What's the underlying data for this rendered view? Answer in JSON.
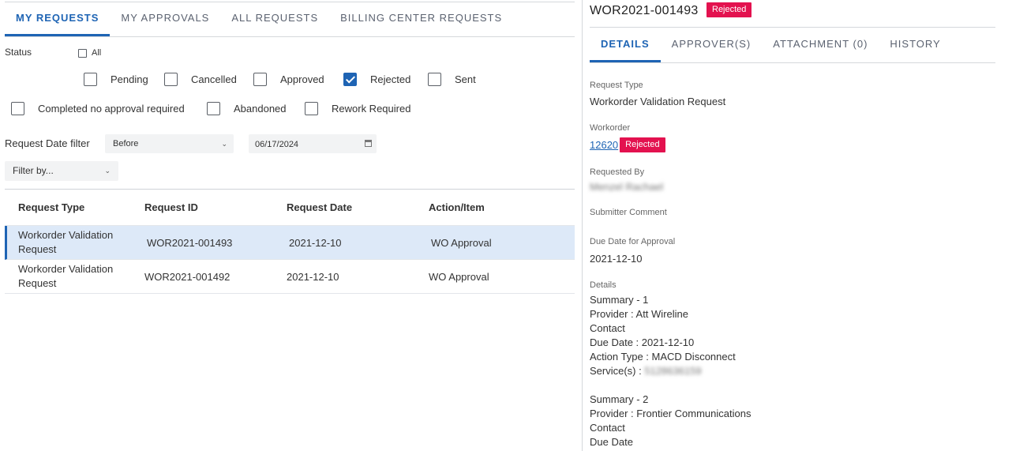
{
  "left": {
    "tabs": [
      {
        "label": "MY REQUESTS",
        "active": true
      },
      {
        "label": "MY APPROVALS",
        "active": false
      },
      {
        "label": "ALL REQUESTS",
        "active": false
      },
      {
        "label": "BILLING CENTER REQUESTS",
        "active": false
      }
    ],
    "status": {
      "label": "Status",
      "all_label": "All",
      "options_row1": [
        {
          "label": "Pending",
          "checked": false
        },
        {
          "label": "Cancelled",
          "checked": false
        },
        {
          "label": "Approved",
          "checked": false
        },
        {
          "label": "Rejected",
          "checked": true
        },
        {
          "label": "Sent",
          "checked": false
        }
      ],
      "options_row2": [
        {
          "label": "Completed no approval required",
          "checked": false
        },
        {
          "label": "Abandoned",
          "checked": false
        },
        {
          "label": "Rework Required",
          "checked": false
        }
      ]
    },
    "date_filter": {
      "label": "Request Date filter",
      "operator": "Before",
      "date": "06/17/2024"
    },
    "filter_by": {
      "placeholder": "Filter by..."
    },
    "table": {
      "headers": [
        "Request Type",
        "Request ID",
        "Request Date",
        "Action/Item"
      ],
      "rows": [
        {
          "type": "Workorder Validation Request",
          "id": "WOR2021-001493",
          "date": "2021-12-10",
          "action": "WO Approval",
          "selected": true
        },
        {
          "type": "Workorder Validation Request",
          "id": "WOR2021-001492",
          "date": "2021-12-10",
          "action": "WO Approval",
          "selected": false
        }
      ]
    }
  },
  "right": {
    "title": "WOR2021-001493",
    "status_badge": "Rejected",
    "tabs": [
      {
        "label": "DETAILS",
        "active": true
      },
      {
        "label": "APPROVER(S)",
        "active": false
      },
      {
        "label": "ATTACHMENT (0)",
        "active": false
      },
      {
        "label": "HISTORY",
        "active": false
      }
    ],
    "request_type": {
      "label": "Request Type",
      "value": "Workorder Validation Request"
    },
    "workorder": {
      "label": "Workorder",
      "link": "12620",
      "badge": "Rejected"
    },
    "requested_by": {
      "label": "Requested By",
      "value": "Menzel Rachael"
    },
    "submitter_comment": {
      "label": "Submitter Comment"
    },
    "due_date": {
      "label": "Due Date for Approval",
      "value": "2021-12-10"
    },
    "details": {
      "label": "Details",
      "summary1": {
        "title": "Summary - 1",
        "provider": "Provider : Att Wireline",
        "contact": "Contact",
        "due_date": "Due Date : 2021-12-10",
        "action_type": "Action Type : MACD Disconnect",
        "services_label": "Service(s) : ",
        "services_value": "5128636159"
      },
      "summary2": {
        "title": "Summary - 2",
        "provider": "Provider : Frontier Communications",
        "contact": "Contact",
        "due_date": "Due Date"
      }
    }
  },
  "colors": {
    "accent": "#1e64b4",
    "badge": "#e3124f",
    "selected_row": "#dde9f8"
  }
}
